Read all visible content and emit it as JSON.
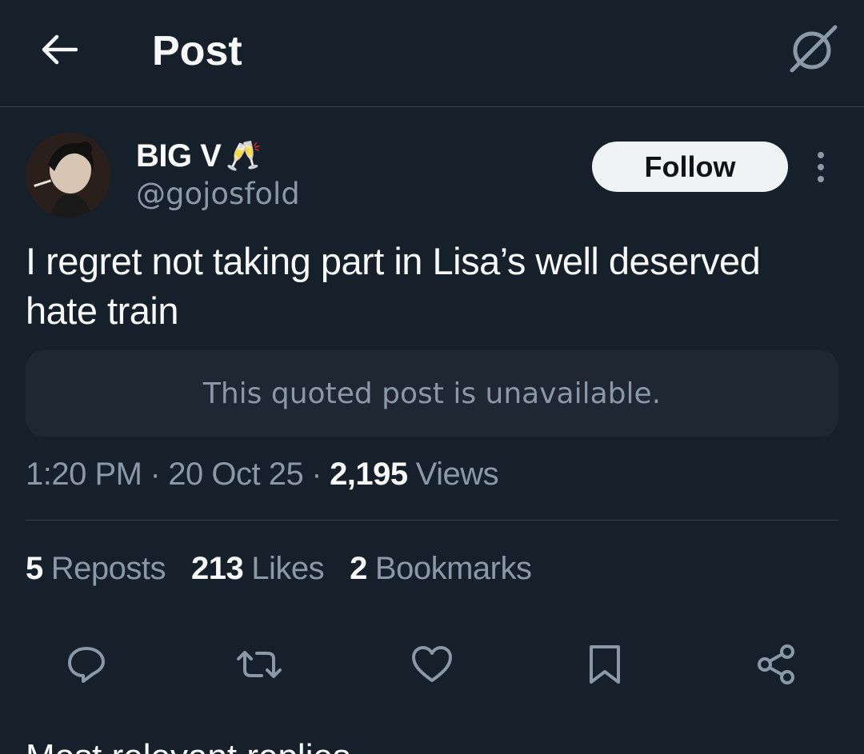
{
  "header": {
    "title": "Post",
    "back_icon": "back-arrow-icon",
    "grok_icon": "grok-icon"
  },
  "author": {
    "display_name": "BIG V",
    "emoji": "🥂",
    "handle": "@gojosfold",
    "follow_label": "Follow"
  },
  "tweet": {
    "text": "I regret not taking part in Lisa’s well deserved hate train",
    "quote_unavailable": "This quoted post is unavailable."
  },
  "meta": {
    "time": "1:20 PM",
    "sep1": "·",
    "date": "20 Oct 25",
    "sep2": "·",
    "views_count": "2,195",
    "views_label": "Views"
  },
  "stats": [
    {
      "count": "5",
      "label": "Reposts"
    },
    {
      "count": "213",
      "label": "Likes"
    },
    {
      "count": "2",
      "label": "Bookmarks"
    }
  ],
  "actions": [
    "reply-icon",
    "repost-icon",
    "like-icon",
    "bookmark-icon",
    "share-icon"
  ],
  "next_post_partial": "Most relevant replies",
  "colors": {
    "background": "#15202b",
    "text_primary": "#f7f9f9",
    "text_secondary": "#8b98a5",
    "divider": "#38444d",
    "quote_bg": "#1e2732",
    "follow_bg": "#eff3f4"
  }
}
